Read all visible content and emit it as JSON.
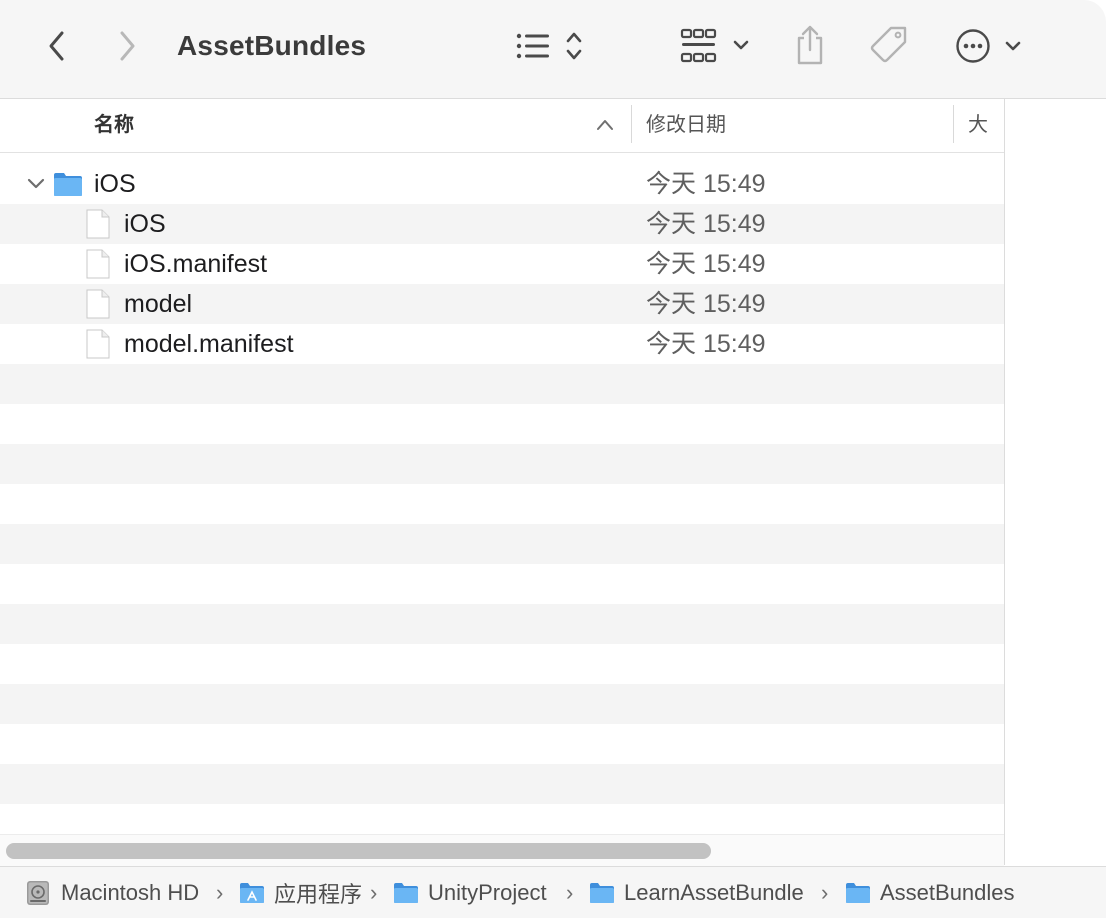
{
  "window": {
    "title": "AssetBundles"
  },
  "toolbar": {
    "back_icon": "chevron-left-icon",
    "forward_icon": "chevron-right-icon",
    "view_icon": "list-view-icon",
    "group_icon": "group-grid-icon",
    "share_icon": "share-icon",
    "tag_icon": "tag-icon",
    "more_icon": "ellipsis-circle-icon"
  },
  "columns": {
    "name": "名称",
    "modified": "修改日期",
    "size": "大小"
  },
  "files": [
    {
      "name": "iOS",
      "kind": "folder",
      "expanded": true,
      "depth": 0,
      "modified": "今天 15:49"
    },
    {
      "name": "iOS",
      "kind": "file",
      "depth": 1,
      "modified": "今天 15:49"
    },
    {
      "name": "iOS.manifest",
      "kind": "file",
      "depth": 1,
      "modified": "今天 15:49"
    },
    {
      "name": "model",
      "kind": "file",
      "depth": 1,
      "modified": "今天 15:49"
    },
    {
      "name": "model.manifest",
      "kind": "file",
      "depth": 1,
      "modified": "今天 15:49"
    }
  ],
  "pathbar": [
    {
      "label": "Macintosh HD",
      "icon": "hard-drive-icon"
    },
    {
      "label": "应用程序",
      "icon": "applications-folder-icon"
    },
    {
      "label": "UnityProject",
      "icon": "folder-icon"
    },
    {
      "label": "LearnAssetBundle",
      "icon": "folder-icon"
    },
    {
      "label": "AssetBundles",
      "icon": "folder-icon"
    }
  ],
  "colors": {
    "folder": "#5aaef0",
    "accent": "#3a8ee6"
  }
}
